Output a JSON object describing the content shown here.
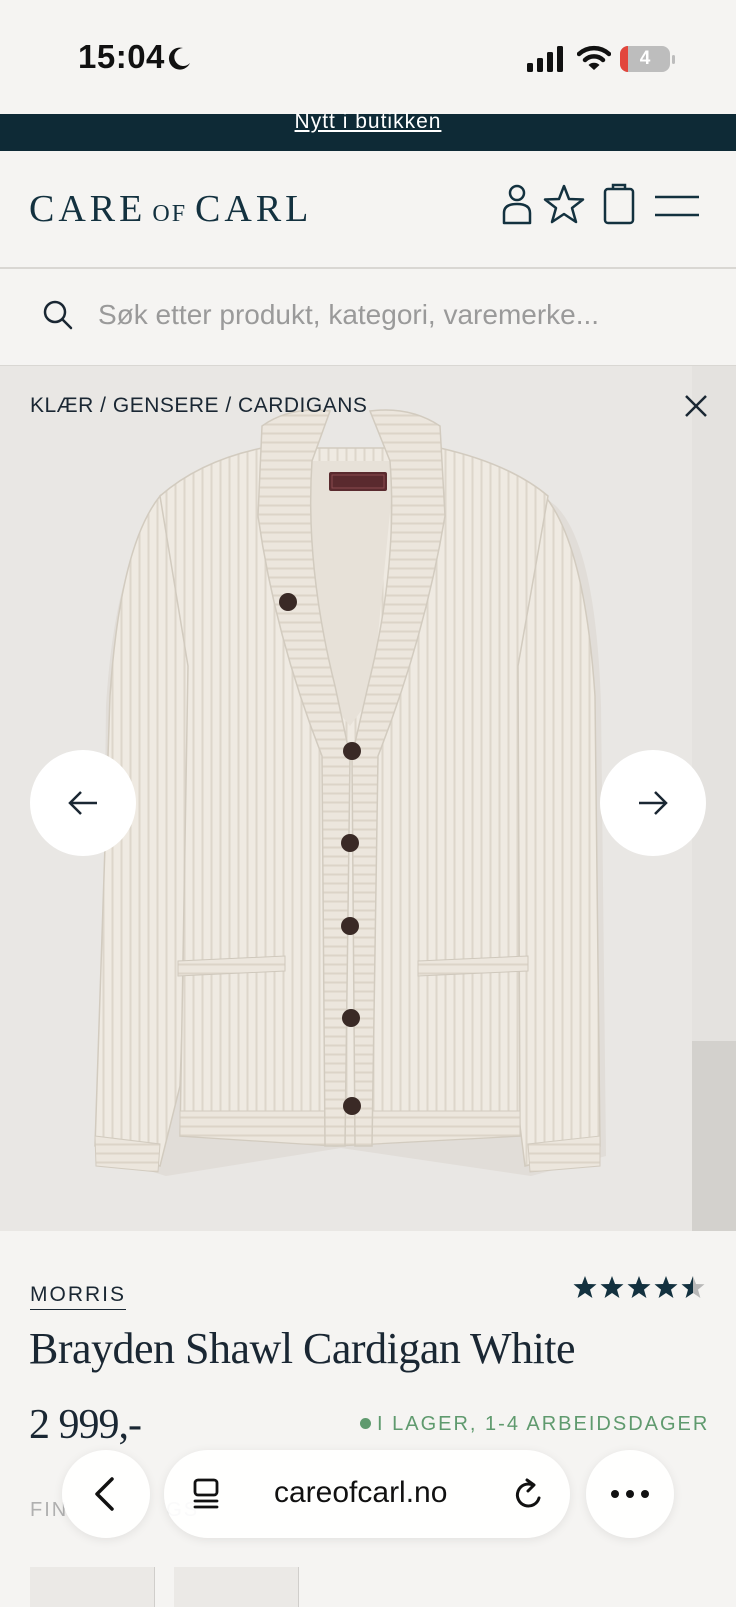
{
  "status_bar": {
    "time": "15:04",
    "battery": "4"
  },
  "promo": {
    "link_text": "Nytt i butikken"
  },
  "header": {
    "logo_left": "CARE",
    "logo_mid": "OF",
    "logo_right": "CARL"
  },
  "search": {
    "placeholder": "Søk etter produkt, kategori, varemerke..."
  },
  "gallery": {
    "breadcrumb": "KLÆR / GENSERE / CARDIGANS"
  },
  "product": {
    "brand": "MORRIS",
    "rating": 4.5,
    "title": "Brayden Shawl Cardigan White",
    "price": "2 999,-",
    "stock": "I LAGER, 1-4 ARBEIDSDAGER",
    "partial_label": "FIN",
    "partial_label_2": "GS"
  },
  "browser": {
    "url": "careofcarl.no"
  },
  "colors": {
    "navy": "#0e2a36",
    "stock_green": "#5f9a6e"
  }
}
